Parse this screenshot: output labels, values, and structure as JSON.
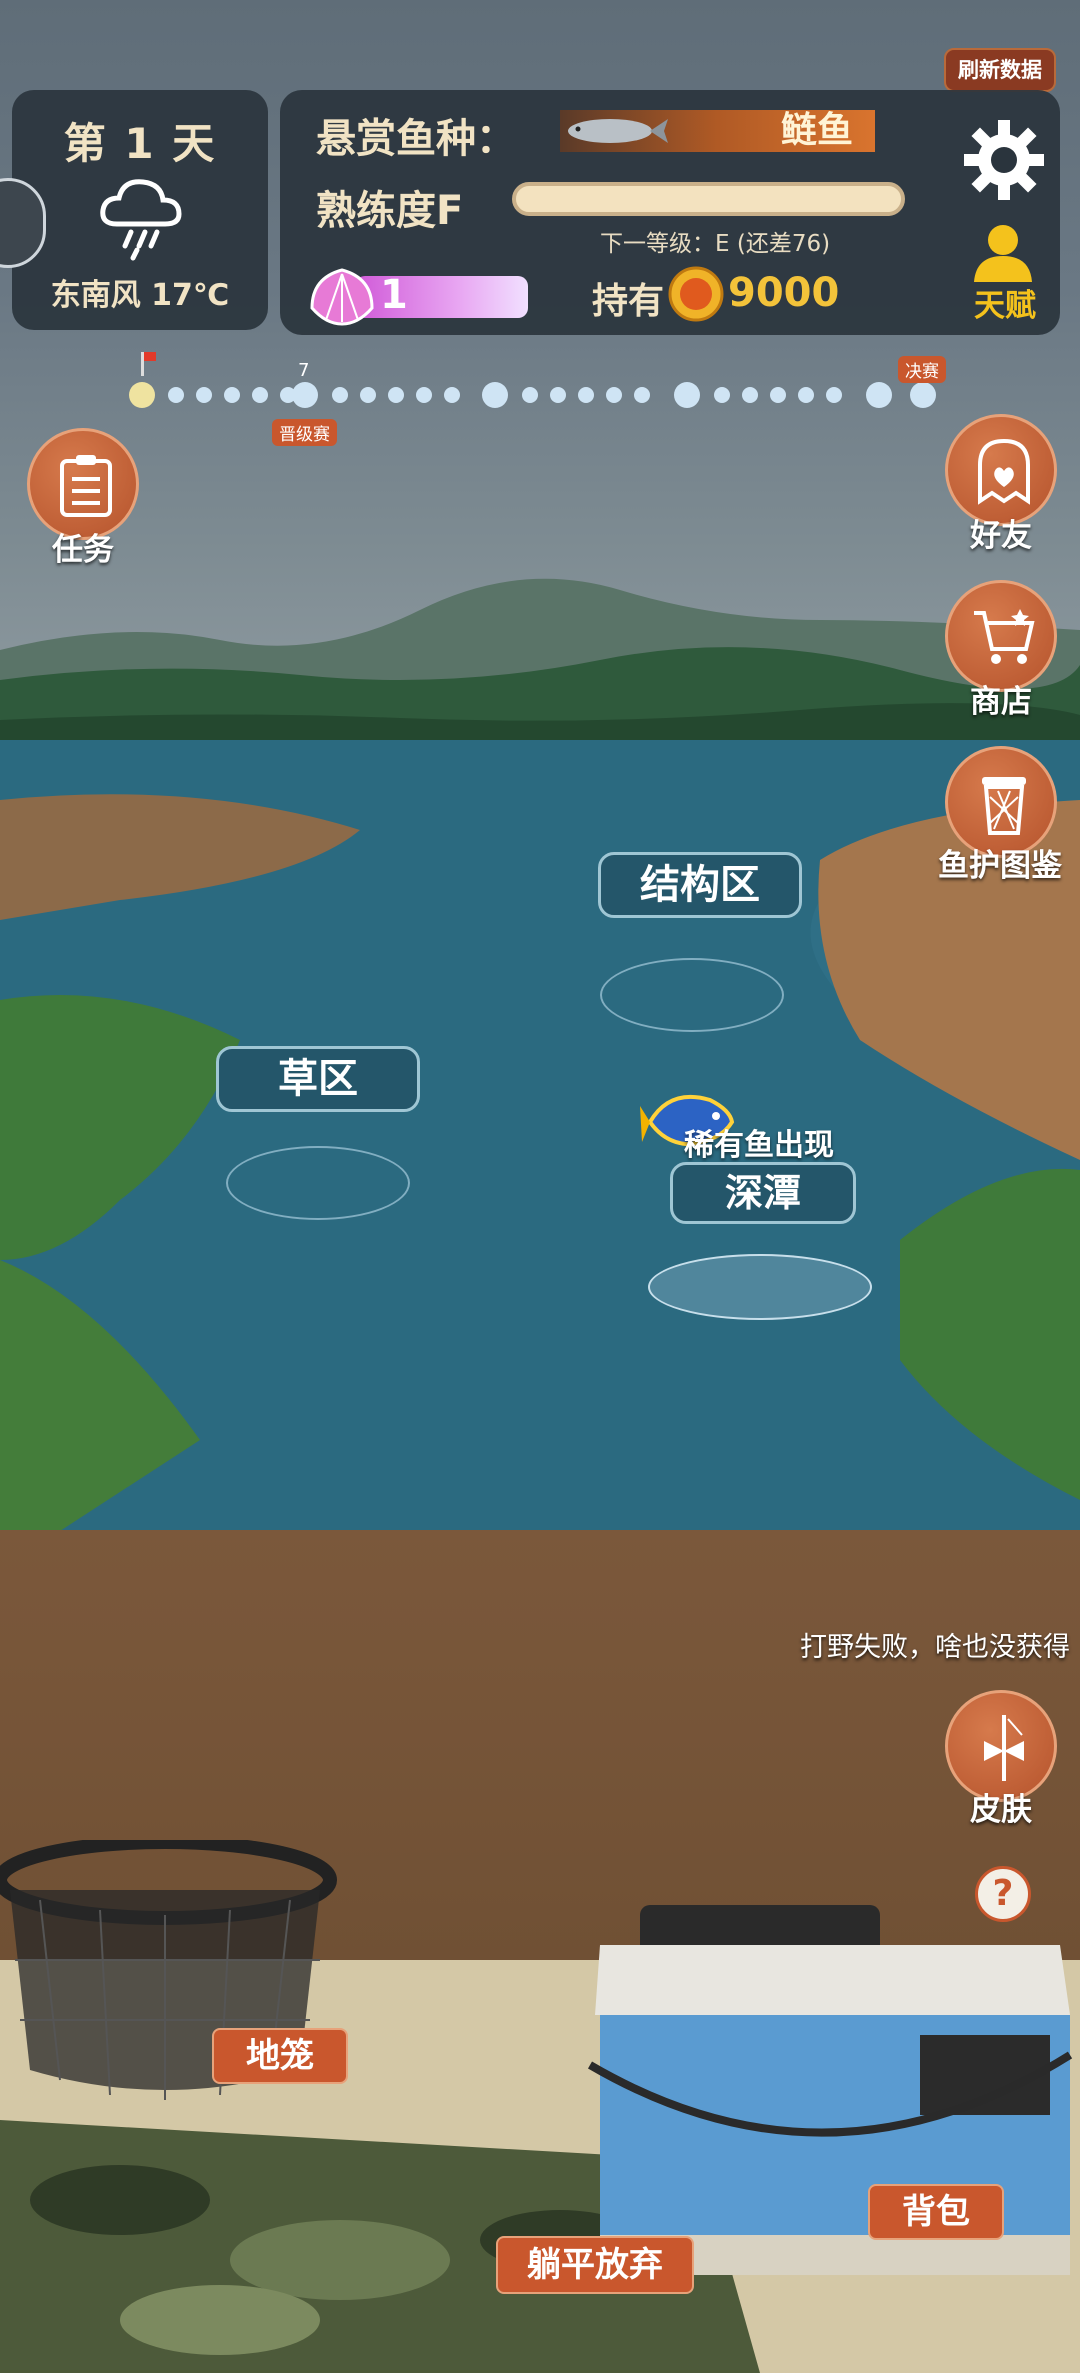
{
  "top": {
    "refresh_label": "刷新数据"
  },
  "day_panel": {
    "day_label": "第 1 天",
    "weather_icon": "rain-cloud-icon",
    "weather_text": "东南风 17℃"
  },
  "info_panel": {
    "bounty_label": "悬赏鱼种：",
    "bounty_fish": "鲢鱼",
    "proficiency_label": "熟练度F",
    "next_level_text": "下一等级：E (还差76)",
    "shell_count": "1",
    "hold_label": "持有",
    "coins": "9000",
    "talent_label": "天赋"
  },
  "track": {
    "mark_label": "7",
    "promotion_tag": "晋级赛",
    "final_tag": "决赛"
  },
  "side_buttons": {
    "tasks": "任务",
    "friends": "好友",
    "shop": "商店",
    "fish_guide": "鱼护图鉴",
    "skins": "皮肤"
  },
  "map": {
    "structure_zone": "结构区",
    "grass_zone": "草区",
    "deep_pool": "深潭",
    "rare_fish_notice": "稀有鱼出现"
  },
  "toast": "打野失败，啥也没获得",
  "bottom": {
    "trap_label": "地笼",
    "bag_label": "背包",
    "give_up_label": "躺平放弃"
  },
  "colors": {
    "accent_orange": "#c9572d",
    "coin_gold": "#f3c33a",
    "panel": "#2a343d"
  }
}
